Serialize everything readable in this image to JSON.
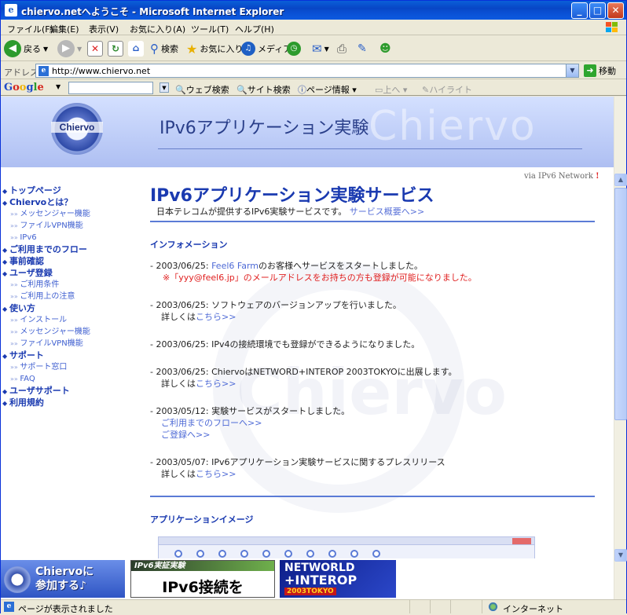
{
  "window": {
    "title": "chiervo.netへようこそ - Microsoft Internet Explorer",
    "app_icon": "e",
    "buttons": {
      "minimize": "_",
      "maximize": "□",
      "close": "✕"
    }
  },
  "menu": [
    "ファイル(F)",
    "編集(E)",
    "表示(V)",
    "お気に入り(A)",
    "ツール(T)",
    "ヘルプ(H)"
  ],
  "toolbar": {
    "back": "戻る",
    "search": "検索",
    "favorites": "お気に入り",
    "media": "メディア"
  },
  "address": {
    "label": "アドレス(D)",
    "url": "http://www.chiervo.net",
    "go": "移動"
  },
  "google": {
    "logo": "Google",
    "web_search": "ウェブ検索",
    "site_search": "サイト検索",
    "page_info": "ページ情報",
    "up": "上へ",
    "highlight": "ハイライト"
  },
  "banner": {
    "logo_text": "Chiervo",
    "title": "IPv6アプリケーション実験",
    "ghost_text": "Chiervo",
    "via": "via IPv6 Network",
    "via_mark": "!"
  },
  "sidebar": [
    {
      "label": "トップページ",
      "type": "main"
    },
    {
      "label": "Chiervoとは？",
      "type": "main"
    },
    {
      "label": "メッセンジャー機能",
      "type": "sub"
    },
    {
      "label": "ファイルVPN機能",
      "type": "sub"
    },
    {
      "label": "IPv6",
      "type": "sub"
    },
    {
      "label": "ご利用までのフロー",
      "type": "main"
    },
    {
      "label": "事前確認",
      "type": "main"
    },
    {
      "label": "ユーザ登録",
      "type": "main"
    },
    {
      "label": "ご利用条件",
      "type": "sub"
    },
    {
      "label": "ご利用上の注意",
      "type": "sub"
    },
    {
      "label": "使い方",
      "type": "main"
    },
    {
      "label": "インストール",
      "type": "sub"
    },
    {
      "label": "メッセンジャー機能",
      "type": "sub"
    },
    {
      "label": "ファイルVPN機能",
      "type": "sub"
    },
    {
      "label": "サポート",
      "type": "main"
    },
    {
      "label": "サポート窓口",
      "type": "sub"
    },
    {
      "label": "FAQ",
      "type": "sub"
    },
    {
      "label": "ユーザサポート",
      "type": "main"
    },
    {
      "label": "利用規約",
      "type": "main"
    }
  ],
  "main": {
    "heading": "IPv6アプリケーション実験サービス",
    "subtitle": "日本テレコムが提供するIPv6実験サービスです。",
    "subtitle_link": "サービス概要へ>>",
    "info_heading": "インフォメーション",
    "news": {
      "n1_date": "- 2003/06/25: ",
      "n1_link": "Feel6 Farm",
      "n1_text": "のお客様へサービスをスタートしました。",
      "n1_note": "※「yyy@feel6.jp」のメールアドレスをお持ちの方も登録が可能になりました。",
      "n2_text": "- 2003/06/25: ソフトウェアのバージョンアップを行いました。",
      "n2_more": "詳しくは",
      "n2_link": "こちら>>",
      "n3_text": "- 2003/06/25: IPv4の接続環境でも登録ができるようになりました。",
      "n4_text": "- 2003/06/25: ChiervoはNETWORD+INTEROP 2003TOKYOに出展します。",
      "n4_more": "詳しくは",
      "n4_link": "こちら>>",
      "n5_text": "- 2003/05/12: 実験サービスがスタートしました。",
      "n5_link1": "ご利用までのフローへ>>",
      "n5_link2": "ご登録へ>>",
      "n6_text": "- 2003/05/07: IPv6アプリケーション実験サービスに関するプレスリリース",
      "n6_more": "詳しくは",
      "n6_link": "こちら>>"
    },
    "app_heading": "アプリケーションイメージ"
  },
  "ads": {
    "ad1_line1": "Chiervoに",
    "ad1_line2": "参加する♪",
    "ad2_top": "IPv6実証実験",
    "ad2_main": "IPv6接続を",
    "ad3_l1": "NETWORLD",
    "ad3_l2": "+INTEROP",
    "ad3_l3": "2003TOKYO"
  },
  "status": {
    "text": "ページが表示されました",
    "zone": "インターネット"
  }
}
